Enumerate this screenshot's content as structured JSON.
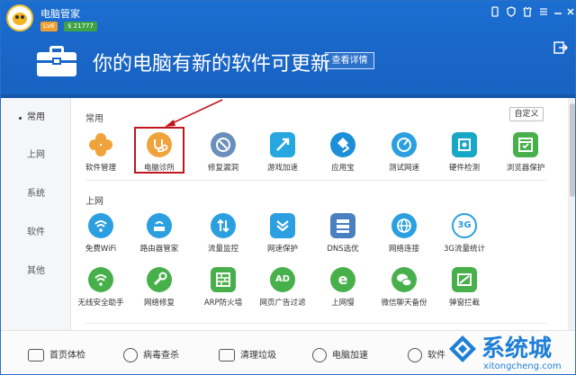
{
  "app": {
    "title": "电脑管家",
    "level": "Lv6",
    "coins": "$ 21777"
  },
  "window_controls": [
    "phone-icon",
    "shield-icon",
    "skin-icon",
    "menu-icon",
    "minimize-icon",
    "close-icon"
  ],
  "header": {
    "headline": "你的电脑有新的软件可更新",
    "detail_button": "查看详情"
  },
  "sidebar": {
    "items": [
      {
        "label": "常用",
        "active": true
      },
      {
        "label": "上网",
        "active": false
      },
      {
        "label": "系统",
        "active": false
      },
      {
        "label": "软件",
        "active": false
      },
      {
        "label": "其他",
        "active": false
      }
    ]
  },
  "main": {
    "custom_button": "自定义",
    "sections": [
      {
        "title": "常用",
        "tools": [
          {
            "label": "软件管理",
            "icon": "clover-icon",
            "color": "#f0a33a"
          },
          {
            "label": "电脑诊所",
            "icon": "stethoscope-icon",
            "color": "#f0a33a",
            "highlighted": true
          },
          {
            "label": "修复漏洞",
            "icon": "patch-icon",
            "color": "#5a84b8"
          },
          {
            "label": "游戏加速",
            "icon": "game-boost-icon",
            "color": "#26a7e0"
          },
          {
            "label": "应用宝",
            "icon": "app-store-icon",
            "color": "#1c8fd8"
          },
          {
            "label": "测试网速",
            "icon": "speed-test-icon",
            "color": "#2b9fe0"
          },
          {
            "label": "硬件检测",
            "icon": "hardware-icon",
            "color": "#19a7c8"
          },
          {
            "label": "浏览器保护",
            "icon": "browser-shield-icon",
            "color": "#48b04a"
          }
        ]
      },
      {
        "title": "上网",
        "tools": [
          {
            "label": "免费WiFi",
            "icon": "wifi-icon",
            "color": "#2b9fe0"
          },
          {
            "label": "路由器管家",
            "icon": "router-icon",
            "color": "#2b9fe0"
          },
          {
            "label": "流量监控",
            "icon": "traffic-icon",
            "color": "#2b9fe0"
          },
          {
            "label": "网速保护",
            "icon": "speed-guard-icon",
            "color": "#2b9fe0"
          },
          {
            "label": "DNS选优",
            "icon": "dns-icon",
            "color": "#4a7fc0"
          },
          {
            "label": "网络连接",
            "icon": "globe-icon",
            "color": "#2b9fe0"
          },
          {
            "label": "3G流量统计",
            "icon": "3g-icon",
            "color": "#2b9fe0"
          }
        ]
      },
      {
        "title": "",
        "tools": [
          {
            "label": "无线安全助手",
            "icon": "wifi-shield-icon",
            "color": "#48b04a"
          },
          {
            "label": "网络修复",
            "icon": "wrench-icon",
            "color": "#48b04a"
          },
          {
            "label": "ARP防火墙",
            "icon": "firewall-icon",
            "color": "#48b04a"
          },
          {
            "label": "网页广告过滤",
            "icon": "ad-filter-icon",
            "color": "#48b04a"
          },
          {
            "label": "上网慢",
            "icon": "ie-icon",
            "color": "#48b04a"
          },
          {
            "label": "微信聊天备份",
            "icon": "wechat-icon",
            "color": "#48b04a"
          },
          {
            "label": "弹窗拦截",
            "icon": "popup-block-icon",
            "color": "#48b04a"
          }
        ]
      }
    ]
  },
  "bottom": {
    "items": [
      {
        "label": "首页体检",
        "icon": "checkup-icon"
      },
      {
        "label": "病毒查杀",
        "icon": "virus-icon"
      },
      {
        "label": "清理垃圾",
        "icon": "broom-icon"
      },
      {
        "label": "电脑加速",
        "icon": "rocket-icon"
      },
      {
        "label": "软件",
        "icon": "software-icon"
      }
    ]
  },
  "watermark": {
    "text": "系统城",
    "url": "xitongcheng.com"
  }
}
